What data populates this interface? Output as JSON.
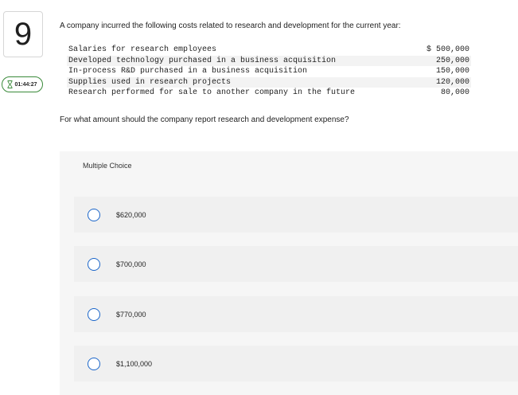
{
  "question_number": "9",
  "timer": {
    "time": "01:44:27",
    "icon": "hourglass-icon"
  },
  "intro": "A company incurred the following costs related to research and development for the current year:",
  "costs": [
    {
      "label": "Salaries for research employees",
      "amount": "$ 500,000"
    },
    {
      "label": "Developed technology purchased in a business acquisition",
      "amount": "250,000"
    },
    {
      "label": "In-process R&D purchased in a business acquisition",
      "amount": "150,000"
    },
    {
      "label": "Supplies used in research projects",
      "amount": "120,000"
    },
    {
      "label": "Research performed for sale to another company in the future",
      "amount": "80,000"
    }
  ],
  "question": "For what amount should the company report research and development expense?",
  "multiple_choice": {
    "label": "Multiple Choice",
    "options": [
      "$620,000",
      "$700,000",
      "$770,000",
      "$1,100,000"
    ]
  },
  "colors": {
    "radio": "#1b66c9",
    "timer_border": "#3a8a3a",
    "panel": "#f6f6f6"
  }
}
